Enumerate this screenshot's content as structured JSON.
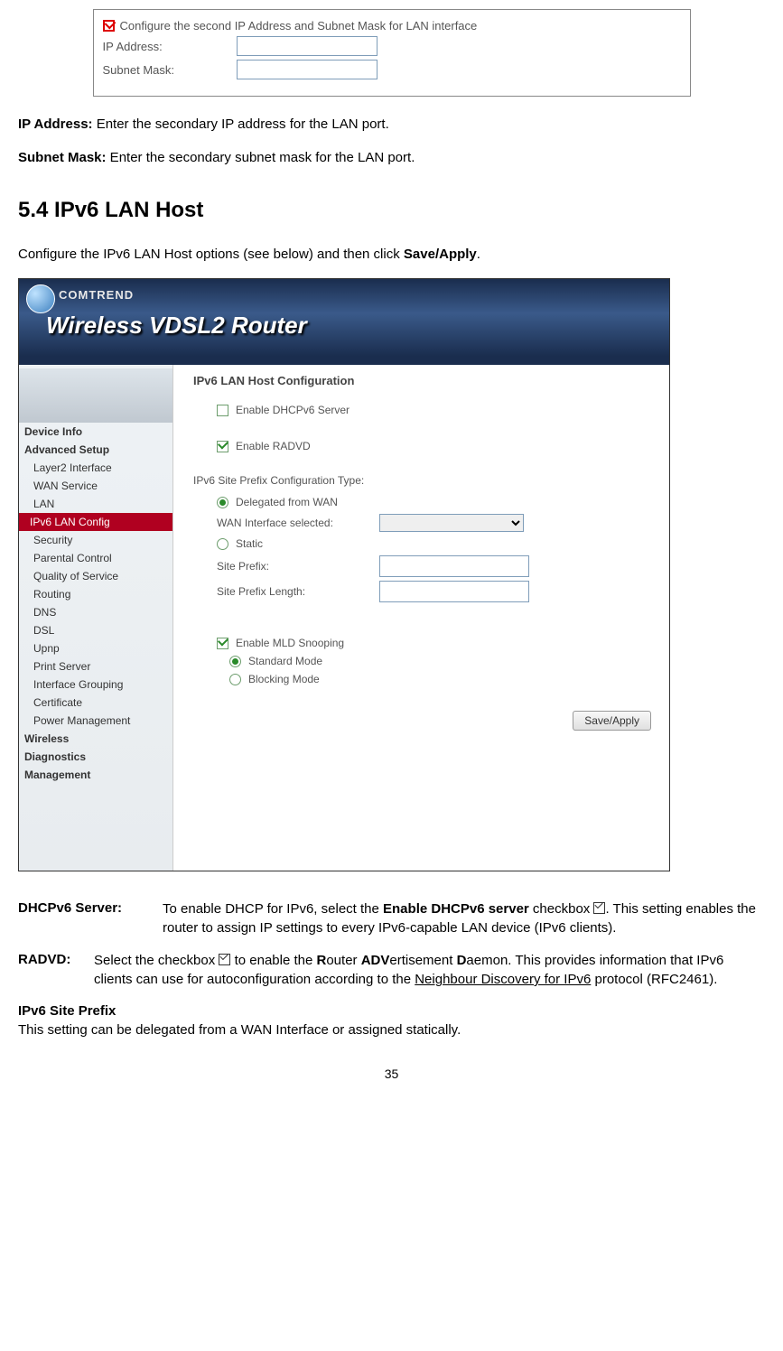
{
  "fig1": {
    "config_label": "Configure the second IP Address and Subnet Mask for LAN interface",
    "ip_label": "IP Address:",
    "subnet_label": "Subnet Mask:"
  },
  "para_ip_label": "IP Address:",
  "para_ip_text": " Enter the secondary IP address for the LAN port.",
  "para_subnet_label": "Subnet Mask:",
  "para_subnet_text": " Enter the secondary subnet mask for the LAN port.",
  "section_heading": "5.4  IPv6  LAN  Host",
  "section_intro_a": "Configure the IPv6 LAN Host options (see below) and then click ",
  "section_intro_b": "Save/Apply",
  "section_intro_c": ".",
  "router": {
    "brand": "COMTREND",
    "title": "Wireless VDSL2 Router",
    "sidebar": {
      "device_info": "Device Info",
      "advanced_setup": "Advanced Setup",
      "layer2": "Layer2 Interface",
      "wan": "WAN Service",
      "lan": "LAN",
      "ipv6": "IPv6 LAN Config",
      "security": "Security",
      "parental": "Parental Control",
      "qos": "Quality of Service",
      "routing": "Routing",
      "dns": "DNS",
      "dsl": "DSL",
      "upnp": "Upnp",
      "print": "Print Server",
      "iface_group": "Interface Grouping",
      "cert": "Certificate",
      "power": "Power Management",
      "wireless": "Wireless",
      "diag": "Diagnostics",
      "mgmt": "Management"
    },
    "content": {
      "title": "IPv6 LAN Host Configuration",
      "enable_dhcpv6": "Enable DHCPv6 Server",
      "enable_radvd": "Enable RADVD",
      "prefix_type": "IPv6 Site Prefix Configuration Type:",
      "delegated": "Delegated from WAN",
      "wan_selected": "WAN Interface selected:",
      "static": "Static",
      "site_prefix": "Site Prefix:",
      "site_prefix_len": "Site Prefix Length:",
      "enable_mld": "Enable MLD Snooping",
      "standard_mode": "Standard Mode",
      "blocking_mode": "Blocking Mode",
      "save": "Save/Apply"
    }
  },
  "defs": {
    "dhcp_label": "DHCPv6 Server:",
    "dhcp_a": "To enable DHCP for IPv6, select the ",
    "dhcp_b": "Enable DHCPv6 server",
    "dhcp_c": " checkbox ",
    "dhcp_d": ". This setting enables the router to assign IP settings to every IPv6-capable LAN device (IPv6 clients).",
    "radvd_label": "RADVD:",
    "radvd_a": "Select the checkbox ",
    "radvd_b": " to enable the ",
    "radvd_c": "R",
    "radvd_d": "outer ",
    "radvd_e": "ADV",
    "radvd_f": "ertisement ",
    "radvd_g": "D",
    "radvd_h": "aemon. This provides information that IPv6 clients can use for autoconfiguration according to the ",
    "radvd_i": "Neighbour Discovery for IPv6",
    "radvd_j": " protocol (RFC2461).",
    "prefix_h": "IPv6 Site Prefix",
    "prefix_t": "This setting can be delegated from a WAN Interface or assigned statically."
  },
  "page_number": "35"
}
